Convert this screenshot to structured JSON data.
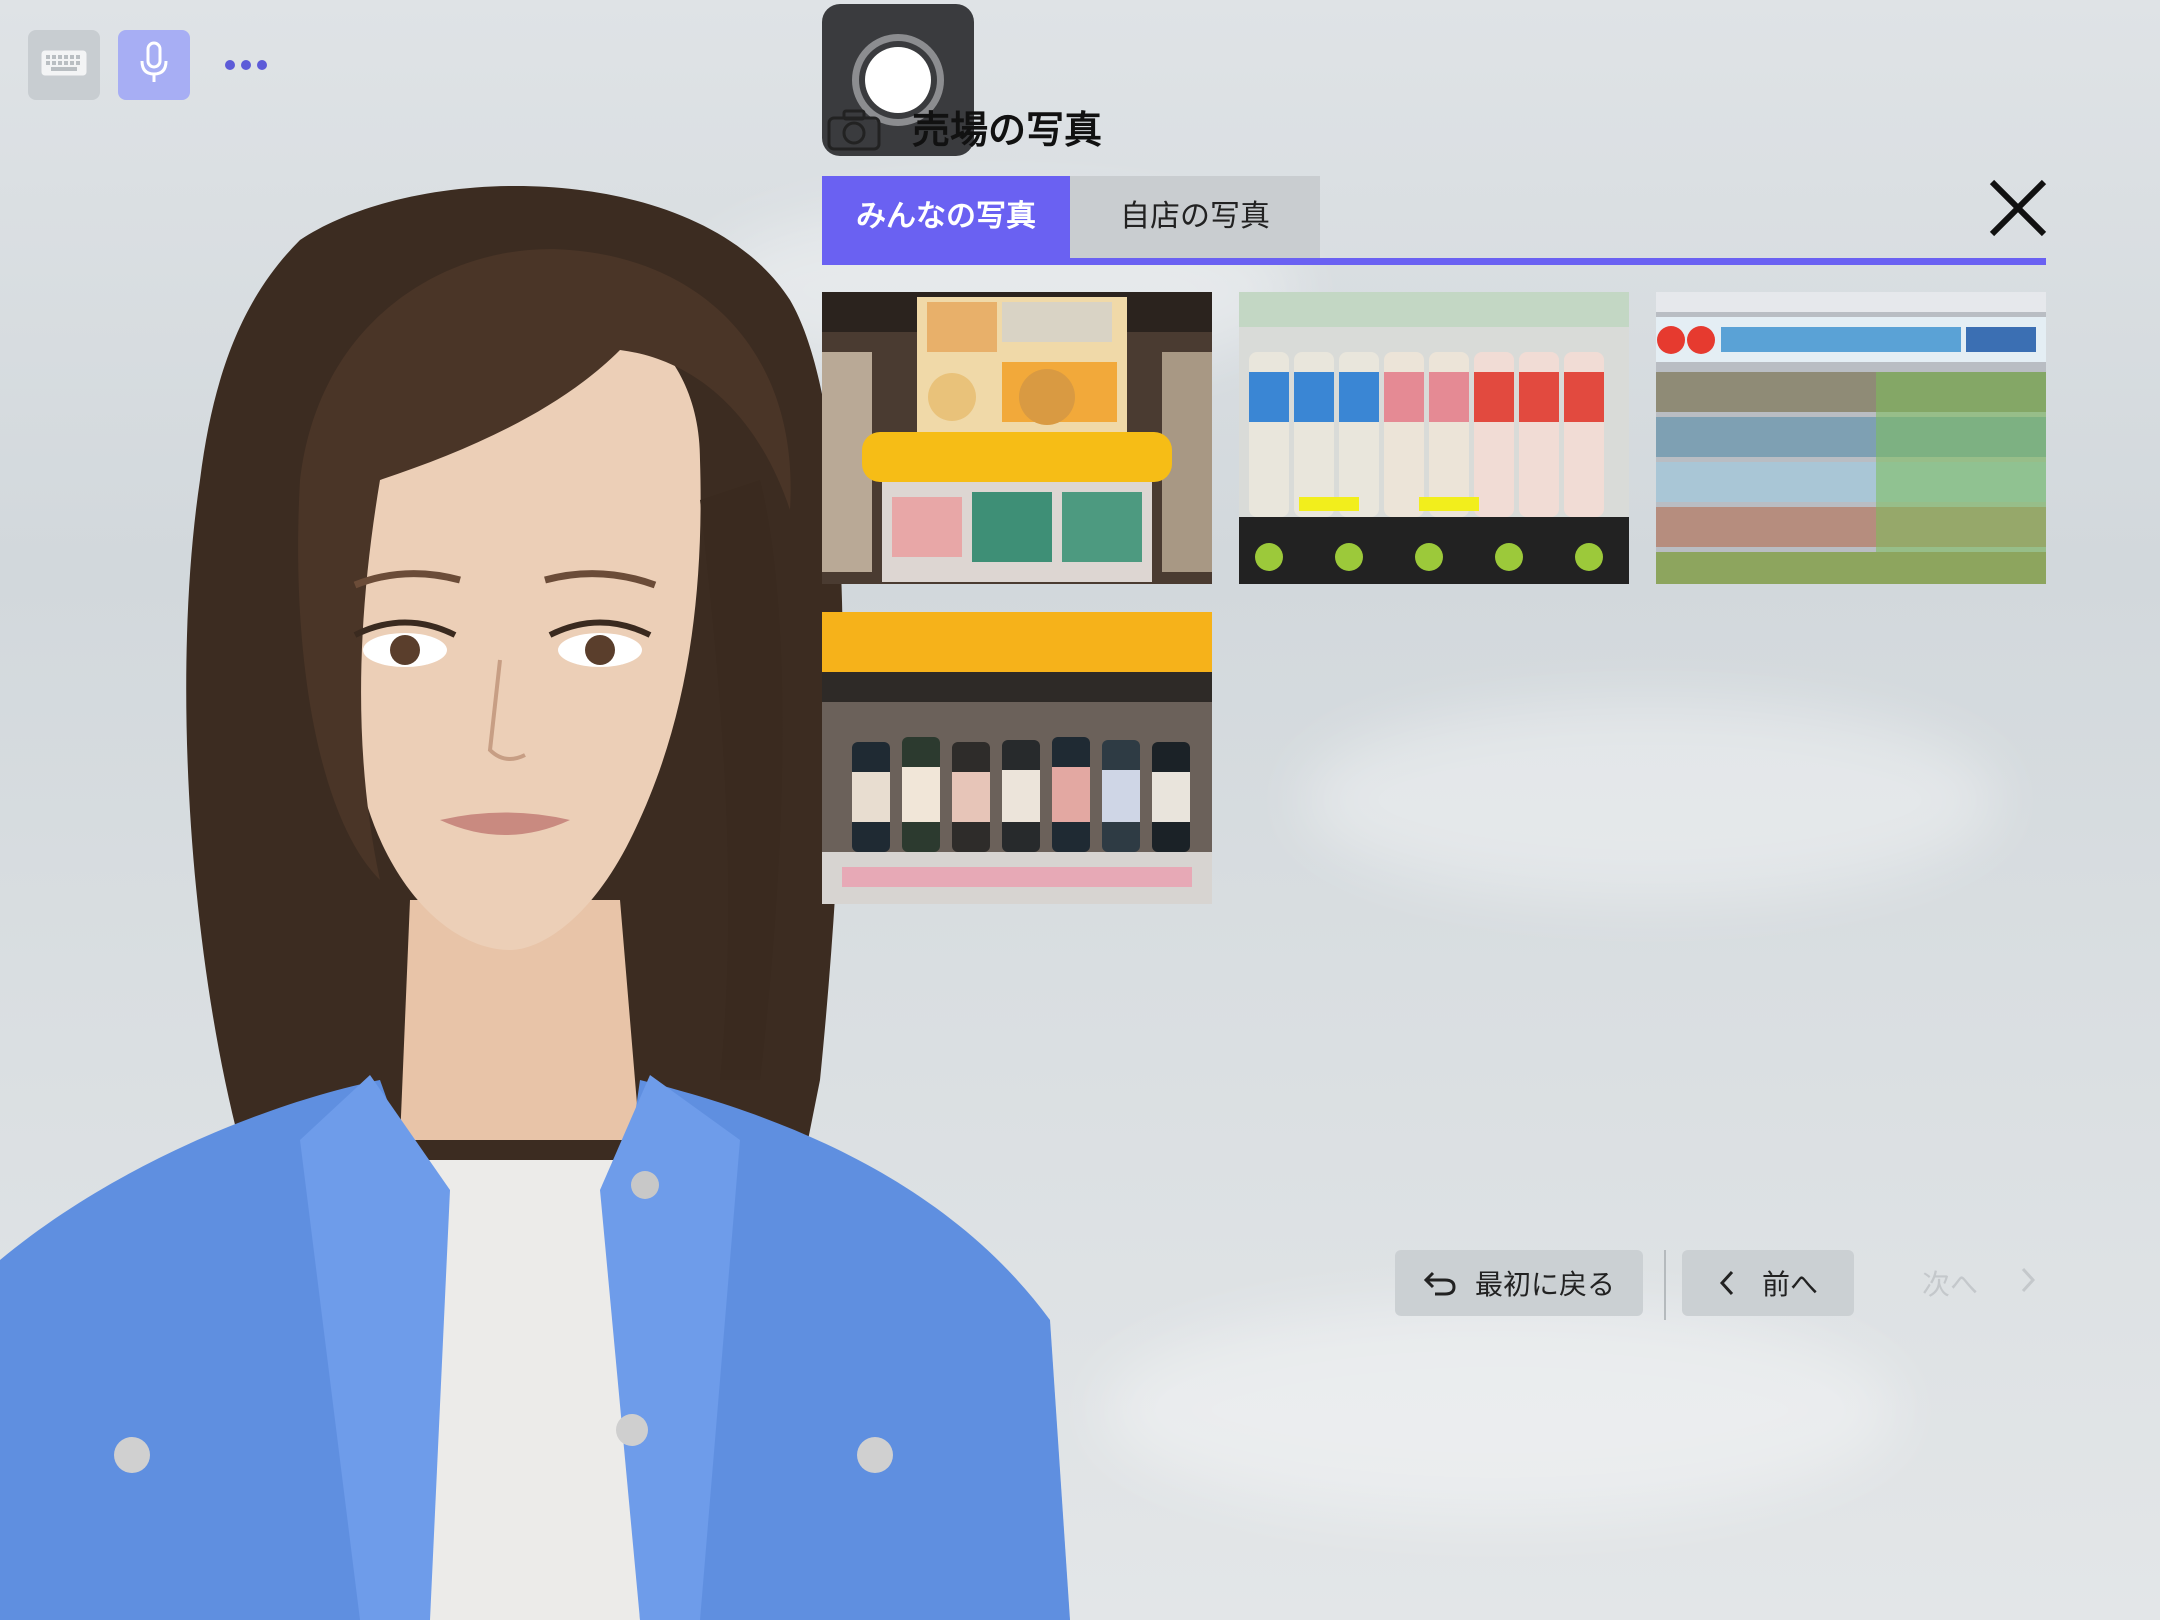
{
  "controls": {
    "keyboard_icon": "keyboard-icon",
    "mic_icon": "microphone-icon",
    "more_icon": "more-dots-icon"
  },
  "panel": {
    "title": "売場の写真",
    "tabs": [
      {
        "label": "みんなの写真",
        "active": true
      },
      {
        "label": "自店の写真",
        "active": false
      }
    ],
    "photos": [
      {
        "subject": "store shelf with crepe dessert display"
      },
      {
        "subject": "bottled tea drinks on shelf"
      },
      {
        "subject": "drink aisle with promotion banner"
      },
      {
        "subject": "bottled jars display under yellow shelf"
      }
    ]
  },
  "nav": {
    "back_label": "最初に戻る",
    "prev_label": "前へ",
    "next_label": "次へ"
  },
  "colors": {
    "accent": "#6a61f2",
    "mic_bg": "#a7aef4"
  }
}
